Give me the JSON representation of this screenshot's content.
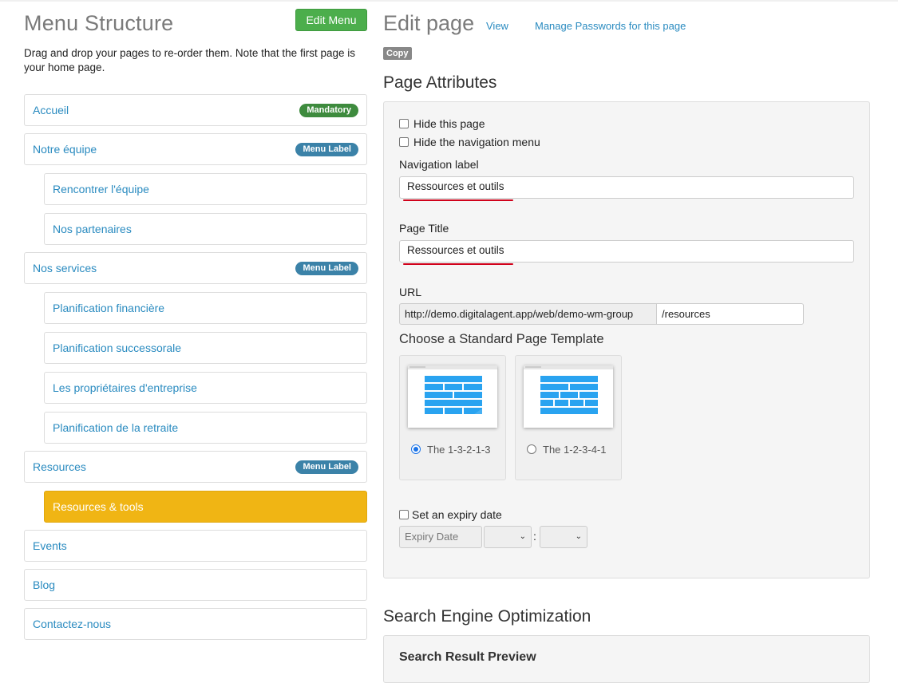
{
  "menu": {
    "title": "Menu Structure",
    "edit_button": "Edit Menu",
    "description": "Drag and drop your pages to re-order them. Note that the first page is your home page.",
    "items": [
      {
        "label": "Accueil",
        "badge": "Mandatory",
        "badge_color": "#3e8b3e",
        "level": 0
      },
      {
        "label": "Notre équipe",
        "badge": "Menu Label",
        "badge_color": "#3b82a8",
        "level": 0
      },
      {
        "label": "Rencontrer l'équipe",
        "badge": "",
        "level": 1
      },
      {
        "label": "Nos partenaires",
        "badge": "",
        "level": 1
      },
      {
        "label": "Nos services",
        "badge": "Menu Label",
        "badge_color": "#3b82a8",
        "level": 0
      },
      {
        "label": "Planification financière",
        "badge": "",
        "level": 1
      },
      {
        "label": "Planification successorale",
        "badge": "",
        "level": 1
      },
      {
        "label": "Les propriétaires d'entreprise",
        "badge": "",
        "level": 1
      },
      {
        "label": "Planification de la retraite",
        "badge": "",
        "level": 1
      },
      {
        "label": "Resources",
        "badge": "Menu Label",
        "badge_color": "#3b82a8",
        "level": 0
      },
      {
        "label": "Resources & tools",
        "badge": "",
        "level": 1,
        "active": true
      },
      {
        "label": "Events",
        "badge": "",
        "level": 0
      },
      {
        "label": "Blog",
        "badge": "",
        "level": 0
      },
      {
        "label": "Contactez-nous",
        "badge": "",
        "level": 0
      }
    ]
  },
  "edit": {
    "title": "Edit page",
    "view_link": "View",
    "passwords_link": "Manage Passwords for this page",
    "copy_badge": "Copy",
    "attributes_title": "Page Attributes",
    "hide_page_label": "Hide this page",
    "hide_nav_label": "Hide the navigation menu",
    "nav_label_label": "Navigation label",
    "nav_label_value": "Ressources et outils",
    "page_title_label": "Page Title",
    "page_title_value": "Ressources et outils",
    "url_label": "URL",
    "url_prefix": "http://demo.digitalagent.app/web/demo-wm-group",
    "url_slug": "/resources",
    "template_title": "Choose a Standard Page Template",
    "templates": [
      {
        "label": "The 1-3-2-1-3",
        "selected": true
      },
      {
        "label": "The 1-2-3-4-1",
        "selected": false
      }
    ],
    "expiry_label": "Set an expiry date",
    "expiry_placeholder": "Expiry Date",
    "seo_title": "Search Engine Optimization",
    "seo_subtitle": "Search Result Preview"
  },
  "colors": {
    "link": "#2a8bc0",
    "active_item": "#f0b514",
    "edit_menu_button": "#4cae4c",
    "spellcheck_underline": "#d0021b"
  }
}
